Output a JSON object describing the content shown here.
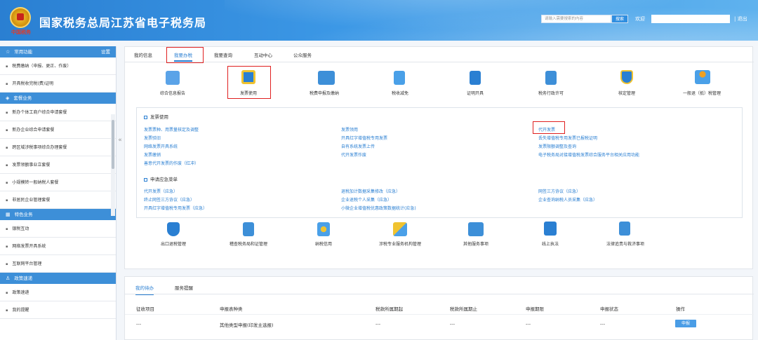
{
  "header": {
    "title": "国家税务总局江苏省电子税务局",
    "emblem_text": "中国税务",
    "search_placeholder": "请输入需要搜索的内容",
    "search_button": "搜索",
    "welcome": "欢迎",
    "logout": "退出"
  },
  "sidebar": {
    "common_head": "常用功能",
    "settings": "设置",
    "common_items": [
      "税费缴纳（申报、更正、作废）",
      "开具税收完税(费)证明"
    ],
    "package_head": "套餐业务",
    "package_items": [
      "新办个体工商户综合申请套餐",
      "新办企业综合申请套餐",
      "跨区域涉税事项综合办理套餐",
      "发票领额事业立套餐",
      "小规模转一般纳税人套餐",
      "非居民企业管理套餐"
    ],
    "feature_head": "特色业务",
    "feature_items": [
      "银税互动",
      "网络发票开具系统",
      "互联网平台管理"
    ],
    "policy_head": "政策速递",
    "policy_items": [
      "政策速递",
      "我的提醒"
    ]
  },
  "tabs": [
    "我的信息",
    "我要办税",
    "我要查询",
    "互动中心",
    "公众服务"
  ],
  "top_icons": [
    "综合信息报告",
    "发票使用",
    "税费申报及缴纳",
    "税收减免",
    "证明开具",
    "税务行政许可",
    "核定管理",
    "一般退（抵）税管理"
  ],
  "invoice_section": {
    "title": "发票使用",
    "col1": [
      "发票票种、用票量核定及调整",
      "发票验旧",
      "网络发票开具系统",
      "发票缴销",
      "善意代开发票的作废（红冲）"
    ],
    "col2": [
      "发票领用",
      "开具红字增值税专用发票",
      "自有系统发票上传",
      "代开发票作废"
    ],
    "col3": [
      "代开发票",
      "丢失增值税专用发票已报税证明",
      "发票限额调整及查询",
      "电子税务局对接增值税发票综合服务平台相关应用功能"
    ]
  },
  "emergency_section": {
    "title": "申请应急菜单",
    "col1": [
      "代开发票（应急）",
      "终止网签三方协议（应急）",
      "开具红字增值税专用发票（应急）"
    ],
    "col2": [
      "退税加计数据采集修改（应急）",
      "企业退税个人采集（应急）",
      "小微企业增值税优惠政策数据统计(应急)"
    ],
    "col3": [
      "网签三方协议（应急）",
      "企业查询纳税人员采集（应急）"
    ]
  },
  "bottom_icons": [
    "出口退税管理",
    "稽查税务局和证管理",
    "纳税信用",
    "涉税专业服务机构管理",
    "其他服务事项",
    "线上执法",
    "法律追责与救济事项"
  ],
  "todo": {
    "tabs": [
      "我的待办",
      "服务提醒"
    ],
    "columns": [
      "征收项目",
      "申报表种类",
      "税款所属期起",
      "税款所属期止",
      "申报期限",
      "申报状态",
      "操作"
    ],
    "row": [
      "---",
      "其他类型申报(印发主选报)",
      "---",
      "---",
      "---",
      "---"
    ],
    "action": "申报"
  },
  "colors": {
    "accent": "#2a7fd2",
    "highlight": "#e02020"
  }
}
